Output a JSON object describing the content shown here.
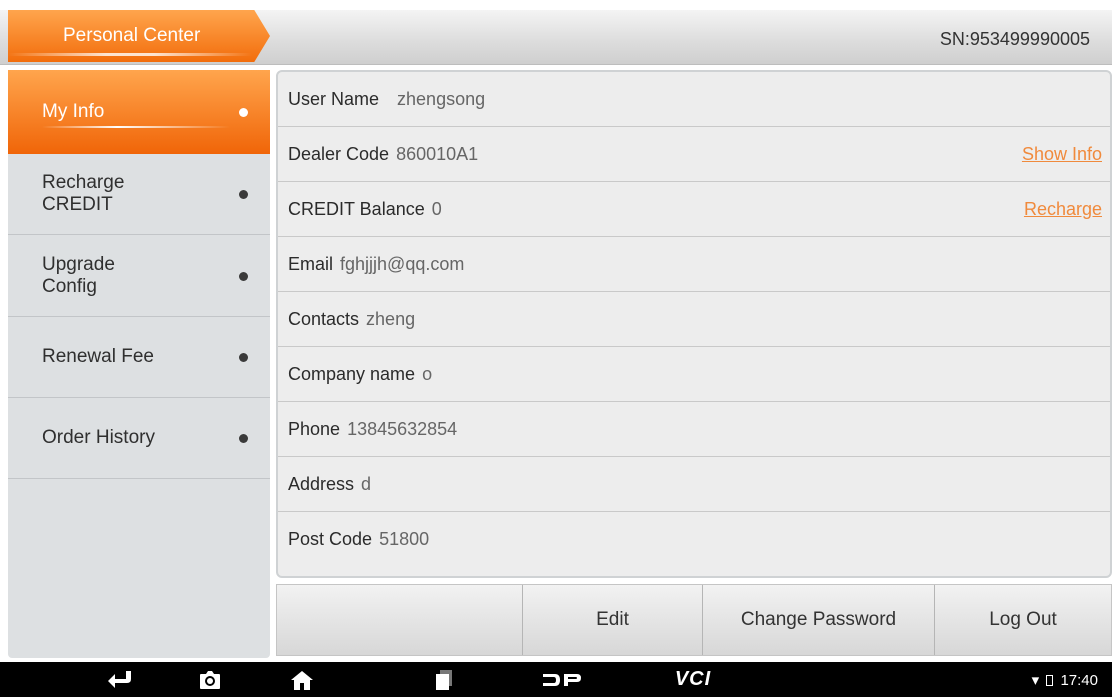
{
  "header": {
    "title": "Personal Center",
    "serial": "SN:953499990005"
  },
  "sidebar": {
    "items": [
      {
        "label": "My Info"
      },
      {
        "label": "Recharge CREDIT"
      },
      {
        "label": "Upgrade Config"
      },
      {
        "label": "Renewal Fee"
      },
      {
        "label": "Order History"
      }
    ]
  },
  "info": {
    "rows": [
      {
        "label": "User Name",
        "value": "zhengsong"
      },
      {
        "label": "Dealer Code",
        "value": "860010A1",
        "action": "Show Info"
      },
      {
        "label": "CREDIT Balance",
        "value": "0",
        "action": "Recharge"
      },
      {
        "label": "Email",
        "value": "fghjjjh@qq.com"
      },
      {
        "label": "Contacts",
        "value": "zheng"
      },
      {
        "label": "Company name",
        "value": "o"
      },
      {
        "label": "Phone",
        "value": "13845632854"
      },
      {
        "label": "Address",
        "value": "d"
      },
      {
        "label": "Post Code",
        "value": "51800"
      }
    ]
  },
  "buttons": {
    "edit": "Edit",
    "change_password": "Change Password",
    "log_out": "Log Out"
  },
  "navbar": {
    "icons": [
      "back-icon",
      "camera-icon",
      "home-icon",
      "recent-apps-icon",
      "dp-logo-icon",
      "vci-icon"
    ],
    "vci_label": "VCI",
    "time": "17:40"
  },
  "colors": {
    "accent": "#f26d0c",
    "link": "#f08a3c"
  }
}
